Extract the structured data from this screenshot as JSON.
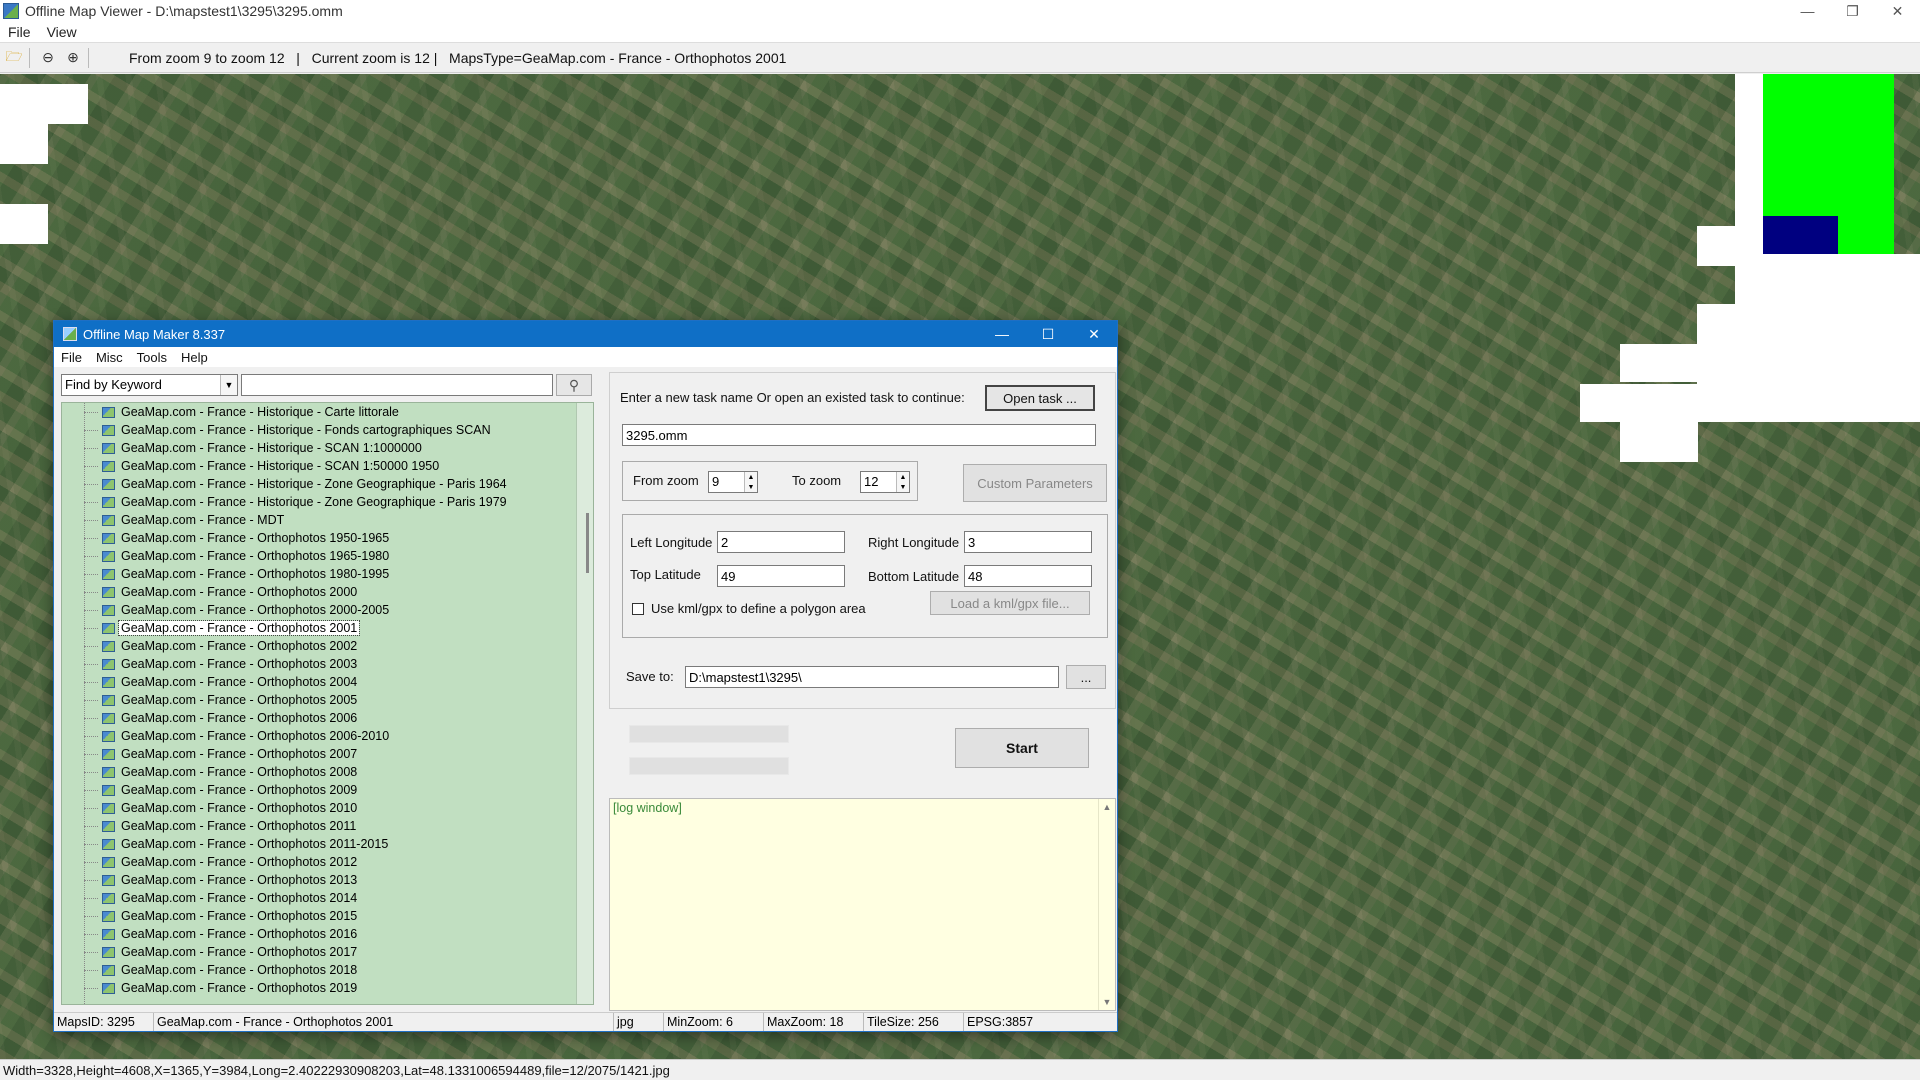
{
  "viewer": {
    "title": "Offline Map Viewer - D:\\mapstest1\\3295\\3295.omm",
    "menu": [
      "File",
      "View"
    ],
    "toolbar_info": "From zoom 9 to zoom 12   |   Current zoom is 12 |   MapsType=GeaMap.com - France - Orthophotos 2001",
    "status": "Width=3328,Height=4608,X=1365,Y=3984,Long=2.40222930908203,Lat=48.1331006594489,file=12/2075/1421.jpg",
    "colors": {
      "overview_green": "#00ff00",
      "overview_blue": "#000080",
      "titlebar": "#0f6fc6",
      "tree_bg": "#c1dfc1",
      "log_bg": "#ffffe1"
    }
  },
  "dialog": {
    "title": "Offline Map Maker 8.337",
    "menu": [
      "File",
      "Misc",
      "Tools",
      "Help"
    ],
    "search": {
      "mode": "Find by Keyword",
      "value": ""
    },
    "tree_items": [
      "GeaMap.com - France - Historique - Carte littorale",
      "GeaMap.com - France - Historique - Fonds cartographiques SCAN",
      "GeaMap.com - France - Historique - SCAN 1:1000000",
      "GeaMap.com - France - Historique - SCAN 1:50000 1950",
      "GeaMap.com - France - Historique - Zone Geographique - Paris 1964",
      "GeaMap.com - France - Historique - Zone Geographique - Paris 1979",
      "GeaMap.com - France - MDT",
      "GeaMap.com - France - Orthophotos 1950-1965",
      "GeaMap.com - France - Orthophotos 1965-1980",
      "GeaMap.com - France - Orthophotos 1980-1995",
      "GeaMap.com - France - Orthophotos 2000",
      "GeaMap.com - France - Orthophotos 2000-2005",
      "GeaMap.com - France - Orthophotos 2001",
      "GeaMap.com - France - Orthophotos 2002",
      "GeaMap.com - France - Orthophotos 2003",
      "GeaMap.com - France - Orthophotos 2004",
      "GeaMap.com - France - Orthophotos 2005",
      "GeaMap.com - France - Orthophotos 2006",
      "GeaMap.com - France - Orthophotos 2006-2010",
      "GeaMap.com - France - Orthophotos 2007",
      "GeaMap.com - France - Orthophotos 2008",
      "GeaMap.com - France - Orthophotos 2009",
      "GeaMap.com - France - Orthophotos 2010",
      "GeaMap.com - France - Orthophotos 2011",
      "GeaMap.com - France - Orthophotos 2011-2015",
      "GeaMap.com - France - Orthophotos 2012",
      "GeaMap.com - France - Orthophotos 2013",
      "GeaMap.com - France - Orthophotos 2014",
      "GeaMap.com - France - Orthophotos 2015",
      "GeaMap.com - France - Orthophotos 2016",
      "GeaMap.com - France - Orthophotos 2017",
      "GeaMap.com - France - Orthophotos 2018",
      "GeaMap.com - France - Orthophotos 2019"
    ],
    "selected_item": "GeaMap.com - France - Orthophotos 2001",
    "task_prompt": "Enter a new task name Or open an existed task to continue:",
    "open_task_label": "Open task ...",
    "task_name": "3295.omm",
    "from_zoom_label": "From zoom",
    "from_zoom": "9",
    "to_zoom_label": "To zoom",
    "to_zoom": "12",
    "custom_params_label": "Custom Parameters",
    "left_lon_label": "Left Longitude",
    "left_lon": "2",
    "right_lon_label": "Right Longitude",
    "right_lon": "3",
    "top_lat_label": "Top Latitude",
    "top_lat": "49",
    "bottom_lat_label": "Bottom Latitude",
    "bottom_lat": "48",
    "kml_label": "Use kml/gpx to define a polygon area",
    "load_kml_label": "Load a kml/gpx file...",
    "save_to_label": "Save to:",
    "save_to": "D:\\mapstest1\\3295\\",
    "browse_label": "...",
    "start_label": "Start",
    "log_text": "[log window]",
    "status": {
      "maps_id": "MapsID: 3295",
      "map_name": "GeaMap.com - France - Orthophotos 2001",
      "format": "jpg",
      "min_zoom": "MinZoom: 6",
      "max_zoom": "MaxZoom: 18",
      "tile_size": "TileSize: 256",
      "epsg": "EPSG:3857"
    }
  }
}
